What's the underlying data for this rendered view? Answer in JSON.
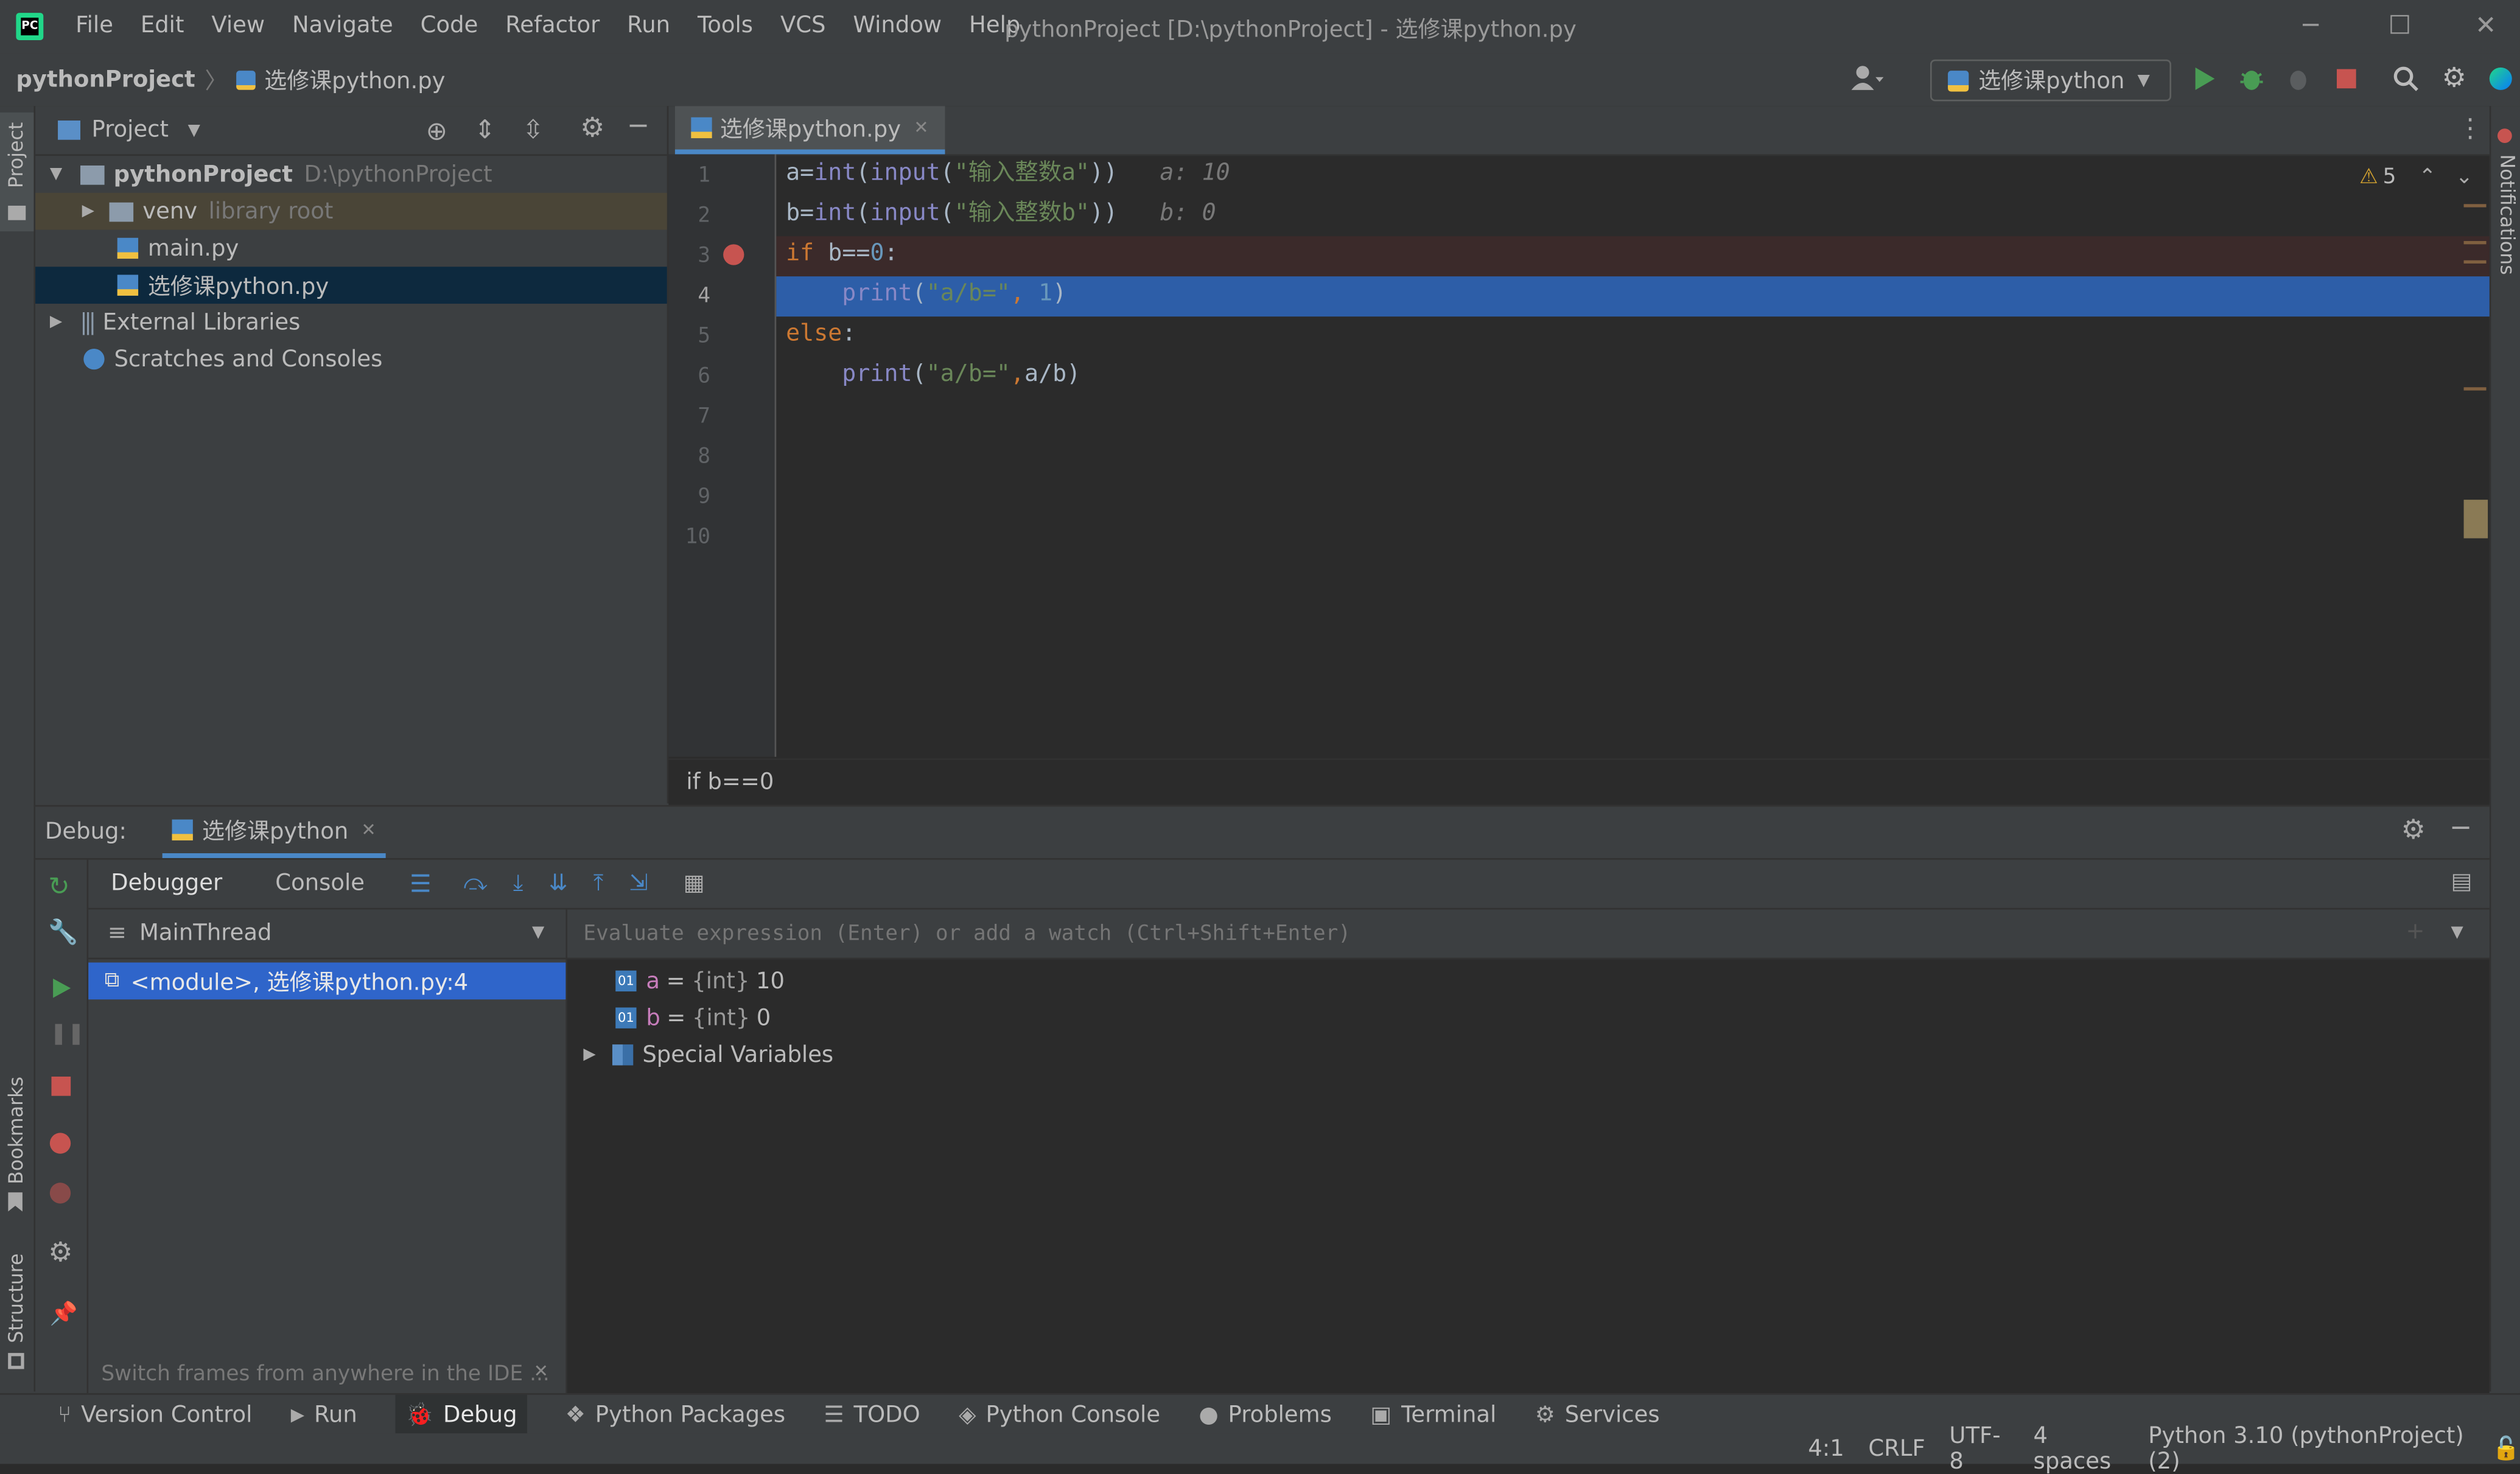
{
  "menu": [
    "File",
    "Edit",
    "View",
    "Navigate",
    "Code",
    "Refactor",
    "Run",
    "Tools",
    "VCS",
    "Window",
    "Help"
  ],
  "window_title": "pythonProject [D:\\pythonProject] - 选修课python.py",
  "nav": {
    "project": "pythonProject",
    "file": "选修课python.py",
    "run_config": "选修课python"
  },
  "left_stripe": {
    "project": "Project",
    "bookmarks": "Bookmarks",
    "structure": "Structure"
  },
  "right_stripe": {
    "notifications": "Notifications"
  },
  "project_panel": {
    "title": "Project",
    "tree": {
      "root": {
        "name": "pythonProject",
        "path": "D:\\pythonProject"
      },
      "venv": {
        "name": "venv",
        "note": "library root"
      },
      "file1": "main.py",
      "file2": "选修课python.py",
      "ext_libs": "External Libraries",
      "scratches": "Scratches and Consoles"
    }
  },
  "editor": {
    "tab": "选修课python.py",
    "warnings": "5",
    "line_numbers": [
      "1",
      "2",
      "3",
      "4",
      "5",
      "6",
      "7",
      "8",
      "9",
      "10"
    ],
    "code": {
      "l1": {
        "a1": "a",
        "a2": "=",
        "f": "int",
        "p1": "(",
        "g": "input",
        "p2": "(",
        "s": "\"输入整数a\"",
        "p3": "))",
        "hint": "a: 10"
      },
      "l2": {
        "a1": "b",
        "a2": "=",
        "f": "int",
        "p1": "(",
        "g": "input",
        "p2": "(",
        "s": "\"输入整数b\"",
        "p3": "))",
        "hint": "b: 0"
      },
      "l3": {
        "kw": "if",
        "t1": " b",
        "op": "==",
        "n": "0",
        "t2": ":"
      },
      "l4": {
        "ind": "    ",
        "f": "print",
        "p1": "(",
        "s": "\"a/b=\"",
        "c": ", ",
        "n": "1",
        "p2": ")"
      },
      "l5": {
        "kw": "else",
        "t": ":"
      },
      "l6": {
        "ind": "    ",
        "f": "print",
        "p1": "(",
        "s": "\"a/b=\"",
        "c": ",",
        "e": "a/b",
        "p2": ")"
      }
    },
    "breadcrumb": "if b==0"
  },
  "debug": {
    "label": "Debug:",
    "tab": "选修课python",
    "sub_tabs": [
      "Debugger",
      "Console"
    ],
    "thread": "MainThread",
    "eval_placeholder": "Evaluate expression (Enter) or add a watch (Ctrl+Shift+Enter)",
    "frame": "<module>, 选修课python.py:4",
    "vars": [
      {
        "name": "a",
        "type": "{int}",
        "value": "10"
      },
      {
        "name": "b",
        "type": "{int}",
        "value": "0"
      }
    ],
    "special": "Special Variables",
    "hint": "Switch frames from anywhere in the IDE ..."
  },
  "bottom_tools": [
    "Version Control",
    "Run",
    "Debug",
    "Python Packages",
    "TODO",
    "Python Console",
    "Problems",
    "Terminal",
    "Services"
  ],
  "status": {
    "pos": "4:1",
    "eol": "CRLF",
    "enc": "UTF-8",
    "indent": "4 spaces",
    "interpreter": "Python 3.10 (pythonProject) (2)"
  },
  "colors": {
    "accent": "#4a88c7",
    "selection": "#2d5ea8",
    "breakpoint_line": "#3b2a2a",
    "breakpoint": "#c75450",
    "run_green": "#499c54"
  }
}
